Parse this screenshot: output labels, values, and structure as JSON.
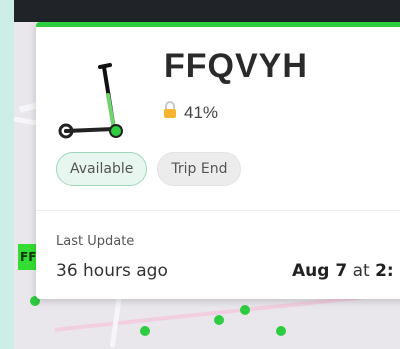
{
  "vehicle": {
    "id": "FFQVYH",
    "battery": "41%",
    "lock_icon": "lock-icon",
    "image": "kick-scooter"
  },
  "status_chips": [
    {
      "label": "Available"
    },
    {
      "label": "Trip End"
    }
  ],
  "last_update": {
    "label": "Last Update",
    "relative": "36 hours ago",
    "date": "Aug 7",
    "at": "at",
    "time": "2:"
  },
  "map": {
    "label": "FF"
  },
  "colors": {
    "accent": "#2ecc40",
    "available_bg": "#e7f6ef",
    "trip_end_bg": "#ececec"
  }
}
